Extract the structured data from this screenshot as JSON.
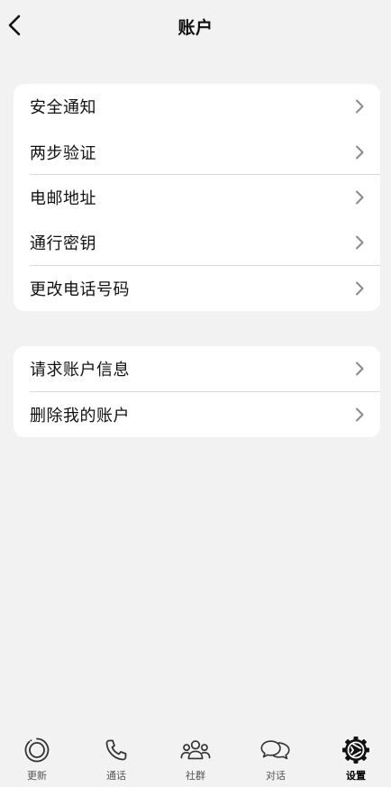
{
  "header": {
    "title": "账户",
    "back_icon": "chevron-left-icon"
  },
  "groups": [
    {
      "items": [
        {
          "label": "安全通知"
        },
        {
          "label": "两步验证"
        },
        {
          "label": "电邮地址"
        },
        {
          "label": "通行密钥"
        },
        {
          "label": "更改电话号码"
        }
      ]
    },
    {
      "items": [
        {
          "label": "请求账户信息"
        },
        {
          "label": "删除我的账户"
        }
      ]
    }
  ],
  "bottom_nav": {
    "active": "设置",
    "items": [
      {
        "label": "更新",
        "icon": "updates-icon"
      },
      {
        "label": "通话",
        "icon": "phone-icon"
      },
      {
        "label": "社群",
        "icon": "communities-icon"
      },
      {
        "label": "对话",
        "icon": "chats-icon"
      },
      {
        "label": "设置",
        "icon": "settings-icon"
      }
    ]
  },
  "colors": {
    "background": "#f2f2f2",
    "card": "#ffffff",
    "divider": "#dadada",
    "chevron": "#8a8a8a"
  }
}
